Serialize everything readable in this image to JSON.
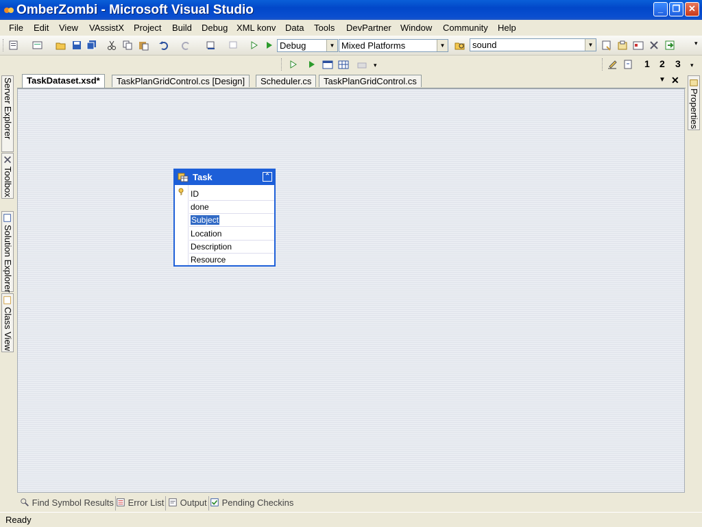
{
  "window": {
    "title": "OmberZombi - Microsoft Visual Studio"
  },
  "menus": [
    "File",
    "Edit",
    "View",
    "VAssistX",
    "Project",
    "Build",
    "Debug",
    "XML konv",
    "Data",
    "Tools",
    "DevPartner",
    "Window",
    "Community",
    "Help"
  ],
  "toolbar": {
    "config": "Debug",
    "platform": "Mixed Platforms",
    "find": "sound",
    "bookmarks": [
      "1",
      "2",
      "3"
    ]
  },
  "tabs": [
    "TaskDataset.xsd*",
    "TaskPlanGridControl.cs [Design]",
    "Scheduler.cs",
    "TaskPlanGridControl.cs"
  ],
  "left_panels": [
    "Server Explorer",
    "Toolbox",
    "Solution Explorer",
    "Class View"
  ],
  "right_panels": [
    "Properties"
  ],
  "table": {
    "name": "Task",
    "columns": [
      "ID",
      "done",
      "Subject",
      "Location",
      "Description",
      "Resource"
    ],
    "selected": "Subject",
    "key_column": "ID"
  },
  "bottom_tabs": [
    "Find Symbol Results",
    "Error List",
    "Output",
    "Pending Checkins"
  ],
  "status": "Ready",
  "colors": {
    "title_bar": "#0247c9",
    "selection": "#316ac5",
    "table_border": "#1d5fd8"
  }
}
